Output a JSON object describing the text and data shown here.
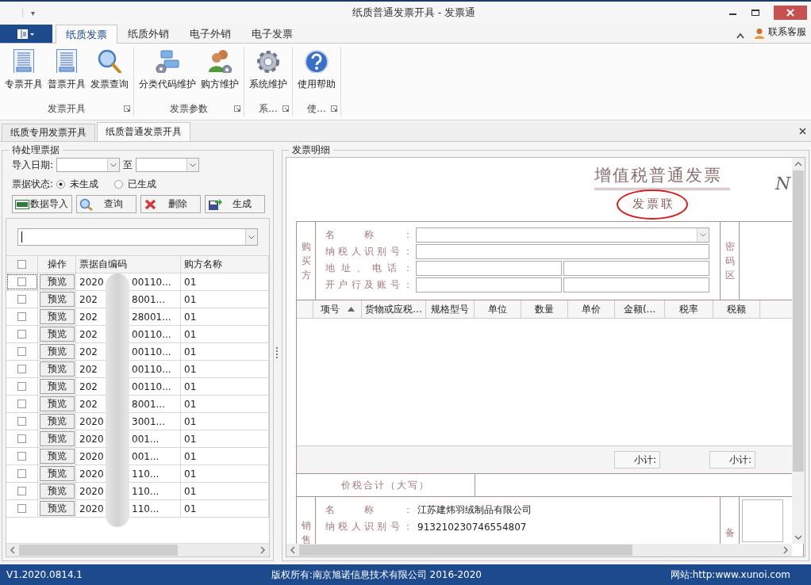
{
  "window": {
    "title": "纸质普通发票开具 - 发票通",
    "quick_access": "▾"
  },
  "ribbon": {
    "tabs": [
      {
        "label": "纸质发票",
        "selected": true
      },
      {
        "label": "纸质外销",
        "selected": false
      },
      {
        "label": "电子外销",
        "selected": false
      },
      {
        "label": "电子发票",
        "selected": false
      }
    ],
    "contact": "联系客服",
    "groups": [
      {
        "title": "发票开具",
        "buttons": [
          {
            "label": "专票开具",
            "kind": "document"
          },
          {
            "label": "普票开具",
            "kind": "document"
          },
          {
            "label": "发票查询",
            "kind": "search"
          }
        ]
      },
      {
        "title": "发票参数",
        "buttons": [
          {
            "label": "分类代码维护",
            "kind": "blocks"
          },
          {
            "label": "购方维护",
            "kind": "users"
          }
        ]
      },
      {
        "title": "系...",
        "buttons": [
          {
            "label": "系统维护",
            "kind": "gear"
          }
        ]
      },
      {
        "title": "使...",
        "buttons": [
          {
            "label": "使用帮助",
            "kind": "help"
          }
        ]
      }
    ]
  },
  "doc_tabs": [
    {
      "label": "纸质专用发票开具",
      "selected": false
    },
    {
      "label": "纸质普通发票开具",
      "selected": true
    }
  ],
  "pending": {
    "title": "待处理票据",
    "date_label": "导入日期:",
    "to_label": "至",
    "status_label": "票据状态:",
    "status_options": [
      {
        "label": "未生成",
        "selected": true
      },
      {
        "label": "已生成",
        "selected": false
      }
    ],
    "buttons": [
      {
        "label": "数据导入",
        "kind": "xls"
      },
      {
        "label": "查询",
        "kind": "search"
      },
      {
        "label": "删除",
        "kind": "delete"
      },
      {
        "label": "生成",
        "kind": "export"
      }
    ],
    "all_checked": false,
    "columns": [
      "操作",
      "票据自编码",
      "购方名称"
    ],
    "rows": [
      {
        "checked": false,
        "action": "预览",
        "code_start": "2020",
        "code_end": "00110...",
        "buyer": "01"
      },
      {
        "checked": false,
        "action": "预览",
        "code_start": "202",
        "code_end": "8001...",
        "buyer": "01"
      },
      {
        "checked": false,
        "action": "预览",
        "code_start": "202",
        "code_end": "28001...",
        "buyer": "01"
      },
      {
        "checked": false,
        "action": "预览",
        "code_start": "202",
        "code_end": "00110...",
        "buyer": "01"
      },
      {
        "checked": false,
        "action": "预览",
        "code_start": "202",
        "code_end": "00110...",
        "buyer": "01"
      },
      {
        "checked": false,
        "action": "预览",
        "code_start": "202",
        "code_end": "00110...",
        "buyer": "01"
      },
      {
        "checked": false,
        "action": "预览",
        "code_start": "202",
        "code_end": "00110...",
        "buyer": "01"
      },
      {
        "checked": false,
        "action": "预览",
        "code_start": "202",
        "code_end": "8001...",
        "buyer": "01"
      },
      {
        "checked": false,
        "action": "预览",
        "code_start": "2020",
        "code_end": "3001...",
        "buyer": "01"
      },
      {
        "checked": false,
        "action": "预览",
        "code_start": "2020",
        "code_end": "001...",
        "buyer": "01"
      },
      {
        "checked": false,
        "action": "预览",
        "code_start": "2020",
        "code_end": "001...",
        "buyer": "01"
      },
      {
        "checked": false,
        "action": "预览",
        "code_start": "2020",
        "code_end": "110...",
        "buyer": "01"
      },
      {
        "checked": false,
        "action": "预览",
        "code_start": "2020",
        "code_end": "110...",
        "buyer": "01"
      },
      {
        "checked": false,
        "action": "预览",
        "code_start": "2020",
        "code_end": "110...",
        "buyer": "01"
      }
    ]
  },
  "detail": {
    "title": "发票明细",
    "invoice_title": "增值税普通发票",
    "copy_label": "发票联",
    "number_label": "N",
    "buyer_side": "购买方",
    "buyer_fields": [
      "名称：",
      "纳税人识别号：",
      "地址、电话：",
      "开户行及账号："
    ],
    "cipher_label": "密码区",
    "columns": [
      "项号",
      "货物或应税...",
      "规格型号",
      "单位",
      "数量",
      "单价",
      "金额(...",
      "税率",
      "税额"
    ],
    "subtotals": [
      "小计:",
      "小计:"
    ],
    "total_label": "价税合计（大写）",
    "seller_side": "销售",
    "seller_fields": [
      {
        "label": "名称：",
        "value": "江苏建炜羽绒制品有限公司"
      },
      {
        "label": "纳税人识别号：",
        "value": "913210230746554807"
      }
    ],
    "remarks_label": "备"
  },
  "status_bar": {
    "version": "V1.2020.0814.1",
    "copyright": "版权所有:南京旭诺信息技术有限公司 2016-2020",
    "website": "网站:http:www.xunoi.com"
  }
}
